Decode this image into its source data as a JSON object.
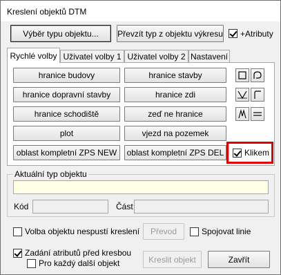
{
  "window": {
    "title": "Kreslení objektů DTM"
  },
  "top": {
    "select_type_label": "Výběr typu objektu...",
    "take_type_label": "Převzít typ z objektu výkresu",
    "attributes_label": "+Atributy",
    "attributes_checked": true
  },
  "tabs": [
    {
      "label": "Rychlé volby",
      "active": true
    },
    {
      "label": "Uživatel volby 1",
      "active": false
    },
    {
      "label": "Uživatel volby 2",
      "active": false
    },
    {
      "label": "Nastavení",
      "active": false
    }
  ],
  "quick": {
    "buttons": [
      {
        "label": "hranice budovy"
      },
      {
        "label": "hranice stavby"
      },
      {
        "label": "hranice dopravní stavby"
      },
      {
        "label": "hranice zdi"
      },
      {
        "label": "hranice schodiště"
      },
      {
        "label": "zeď ne hranice"
      },
      {
        "label": "plot"
      },
      {
        "label": "vjezd na pozemek"
      },
      {
        "label": "oblast kompletní ZPS NEW"
      },
      {
        "label": "oblast kompletní ZPS DEL"
      }
    ],
    "icons": [
      "rectangle-icon",
      "rounded-corner-icon",
      "v-shape-icon",
      "corner-shape-icon",
      "peak-icon",
      "double-line-icon"
    ],
    "klikem_label": "Klikem",
    "klikem_checked": true,
    "highlight_color": "#e00000"
  },
  "current": {
    "legend": "Aktuální typ objektu",
    "type_value": "",
    "type_bg_color": "#ffffe6",
    "kod_label": "Kód",
    "kod_value": "",
    "cast_label": "Část",
    "cast_value": ""
  },
  "bottom": {
    "no_stop_label": "Volba objektu nespustí kreslení",
    "no_stop_checked": false,
    "prevod_label": "Převod",
    "join_lines_label": "Spojovat linie",
    "join_lines_checked": false,
    "attr_before_label": "Zadání atributů před kresbou",
    "attr_before_checked": true,
    "each_next_label": "Pro každý další objekt",
    "each_next_checked": false,
    "draw_label": "Kreslit objekt",
    "close_label": "Zavřít"
  }
}
